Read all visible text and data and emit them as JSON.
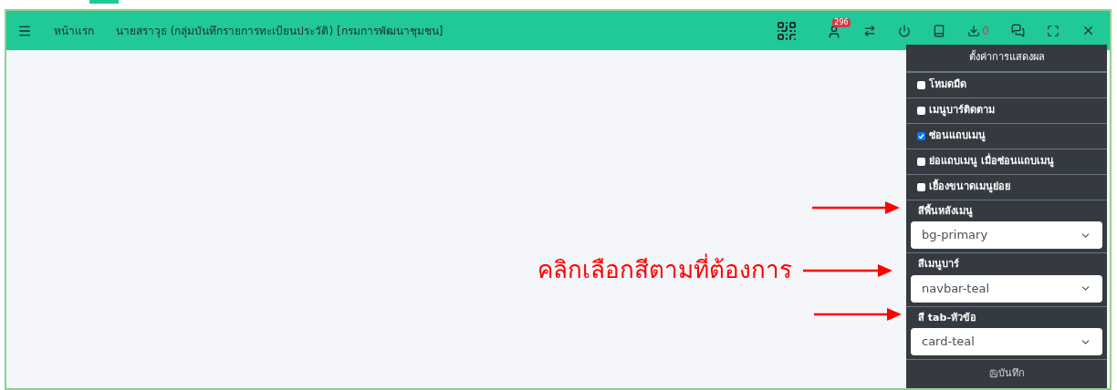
{
  "navbar": {
    "links": [
      "หน้าแรก",
      "นายสราวุธ (กลุ่มบันทึกรายการทะเบียนประวัติ) [กรมการพัฒนาชุมชน]"
    ],
    "notification_count": "296",
    "download_count": "0"
  },
  "settings_panel": {
    "title": "ตั้งค่าการแสดงผล",
    "toggles": [
      {
        "label": "โหมดมืด",
        "checked": false
      },
      {
        "label": "เมนูบาร์ติดตาม",
        "checked": false
      },
      {
        "label": "ซ่อนแถบเมนู",
        "checked": true
      },
      {
        "label": "ย่อแถบเมนู เมื่อซ่อนแถบเมนู",
        "checked": false
      },
      {
        "label": "เยื้องขนาดเมนูย่อย",
        "checked": false
      }
    ],
    "selects": [
      {
        "label": "สีพื้นหลังเมนู",
        "value": "bg-primary"
      },
      {
        "label": "สีเมนูบาร์",
        "value": "navbar-teal"
      },
      {
        "label": "สี tab-หัวข้อ",
        "value": "card-teal"
      }
    ],
    "save_button": "บันทึก"
  },
  "annotation": {
    "text": "คลิกเลือกสีตามที่ต้องการ"
  }
}
